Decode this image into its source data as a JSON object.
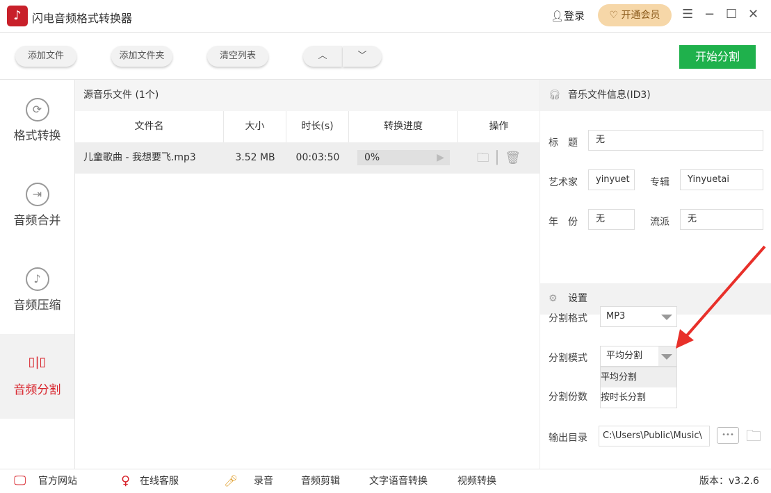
{
  "app": {
    "title": "闪电音频格式转换器"
  },
  "header": {
    "login": "登录",
    "vip": "开通会员",
    "menu_icon": "☰",
    "min_icon": "−",
    "max_icon": "☐",
    "close_icon": "✕"
  },
  "toolbar": {
    "add_file": "添加文件",
    "add_folder": "添加文件夹",
    "clear_list": "清空列表",
    "up": "︿",
    "down": "﹀",
    "start": "开始分割"
  },
  "sidebar": {
    "items": [
      {
        "label": "格式转换",
        "icon": "⟳"
      },
      {
        "label": "音频合并",
        "icon": "⇥"
      },
      {
        "label": "音频压缩",
        "icon": "♪"
      },
      {
        "label": "音频分割",
        "icon": "▯|▯"
      }
    ]
  },
  "list": {
    "title": "源音乐文件 (1个)",
    "columns": [
      "文件名",
      "大小",
      "时长(s)",
      "转换进度",
      "操作"
    ],
    "rows": [
      {
        "name": "儿童歌曲 - 我想要飞.mp3",
        "size": "3.52 MB",
        "duration": "00:03:50",
        "progress": "0%"
      }
    ]
  },
  "info": {
    "title": "音乐文件信息(ID3)",
    "title_label": "标　题",
    "title_value": "无",
    "artist_label": "艺术家",
    "artist_value": "yinyuet",
    "album_label": "专辑",
    "album_value": "Yinyuetai",
    "year_label": "年　份",
    "year_value": "无",
    "genre_label": "流派",
    "genre_value": "无"
  },
  "settings": {
    "title": "设置",
    "format_label": "分割格式",
    "format_value": "MP3",
    "mode_label": "分割模式",
    "mode_value": "平均分割",
    "mode_options": [
      "平均分割",
      "按时长分割"
    ],
    "count_label": "分割份数",
    "output_label": "输出目录",
    "output_value": "C:\\Users\\Public\\Music\\",
    "browse": "•••"
  },
  "footer": {
    "website": "官方网站",
    "support": "在线客服",
    "record": "录音",
    "cut": "音频剪辑",
    "tts": "文字语音转换",
    "video": "视频转换",
    "version": "版本：v3.2.6"
  },
  "colors": {
    "accent": "#d8242c",
    "start": "#1fb14c"
  }
}
